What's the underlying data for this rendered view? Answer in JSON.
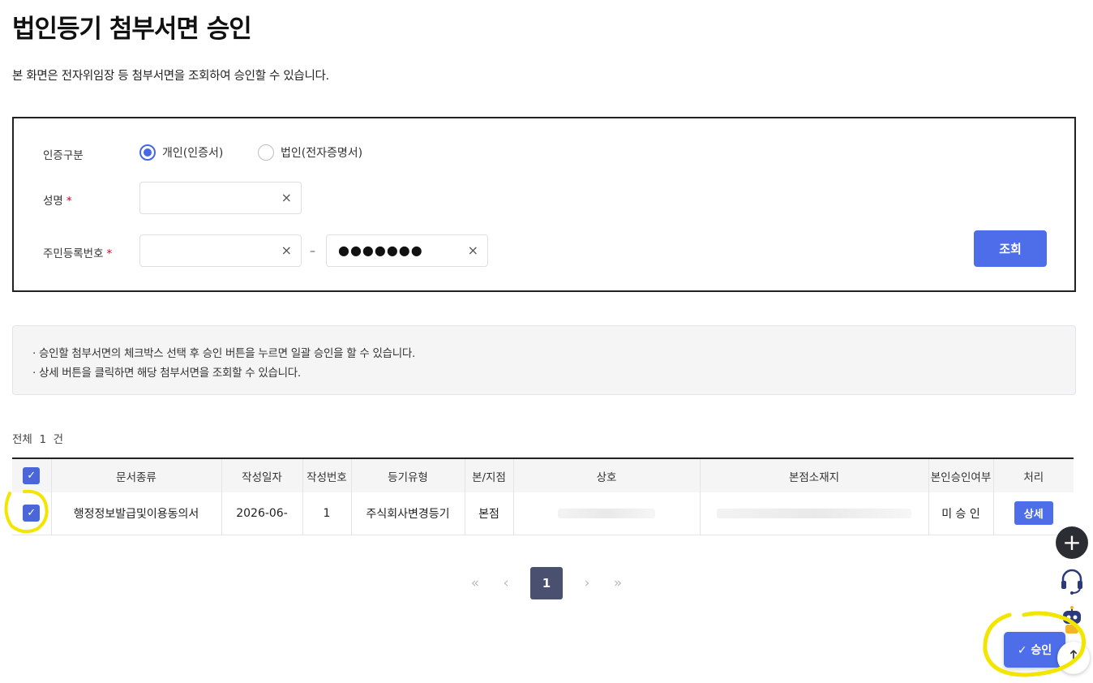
{
  "header": {
    "title": "법인등기 첨부서면 승인",
    "description": "본 화면은 전자위임장 등 첨부서면을 조회하여 승인할 수 있습니다."
  },
  "search": {
    "auth_type_label": "인증구분",
    "options": [
      {
        "label": "개인(인증서)",
        "selected": true
      },
      {
        "label": "법인(전자증명서)",
        "selected": false
      }
    ],
    "name_label": "성명",
    "name_value": "",
    "rrn_label": "주민등록번호",
    "rrn_front_value": "",
    "rrn_dash": "–",
    "rrn_back_masked": "●●●●●●●",
    "required_mark": "*",
    "clear_icon": "×",
    "search_button": "조회"
  },
  "notice": {
    "items": [
      "승인할 첨부서면의 체크박스 선택 후 승인 버튼을 누르면 일괄 승인을 할 수 있습니다.",
      "상세 버튼을 클릭하면 해당 첨부서면을 조회할 수 있습니다."
    ],
    "bullet": "·"
  },
  "results": {
    "total_label": "전체",
    "total_count": "1",
    "total_unit": "건",
    "columns": [
      "문서종류",
      "작성일자",
      "작성번호",
      "등기유형",
      "본/지점",
      "상호",
      "본점소재지",
      "본인승인여부",
      "처리"
    ],
    "rows": [
      {
        "checked": true,
        "doc_type": "행정정보발급및이용동의서",
        "date": "2026-06-",
        "number": "1",
        "reg_type": "주식회사변경등기",
        "branch": "본점",
        "company": "",
        "address": "",
        "approval_status": "미 승 인",
        "action": "상세"
      }
    ]
  },
  "pagination": {
    "first": "«",
    "prev": "‹",
    "current": "1",
    "next": "›",
    "last": "»"
  },
  "floating": {
    "plus": "+",
    "approve_check": "✓",
    "approve_label": "승인",
    "top_arrow": "↑"
  },
  "colors": {
    "primary": "#4d6ee8",
    "checkbox": "#4a66d8",
    "pager_active": "#4a5070",
    "highlight": "#f2e600"
  }
}
